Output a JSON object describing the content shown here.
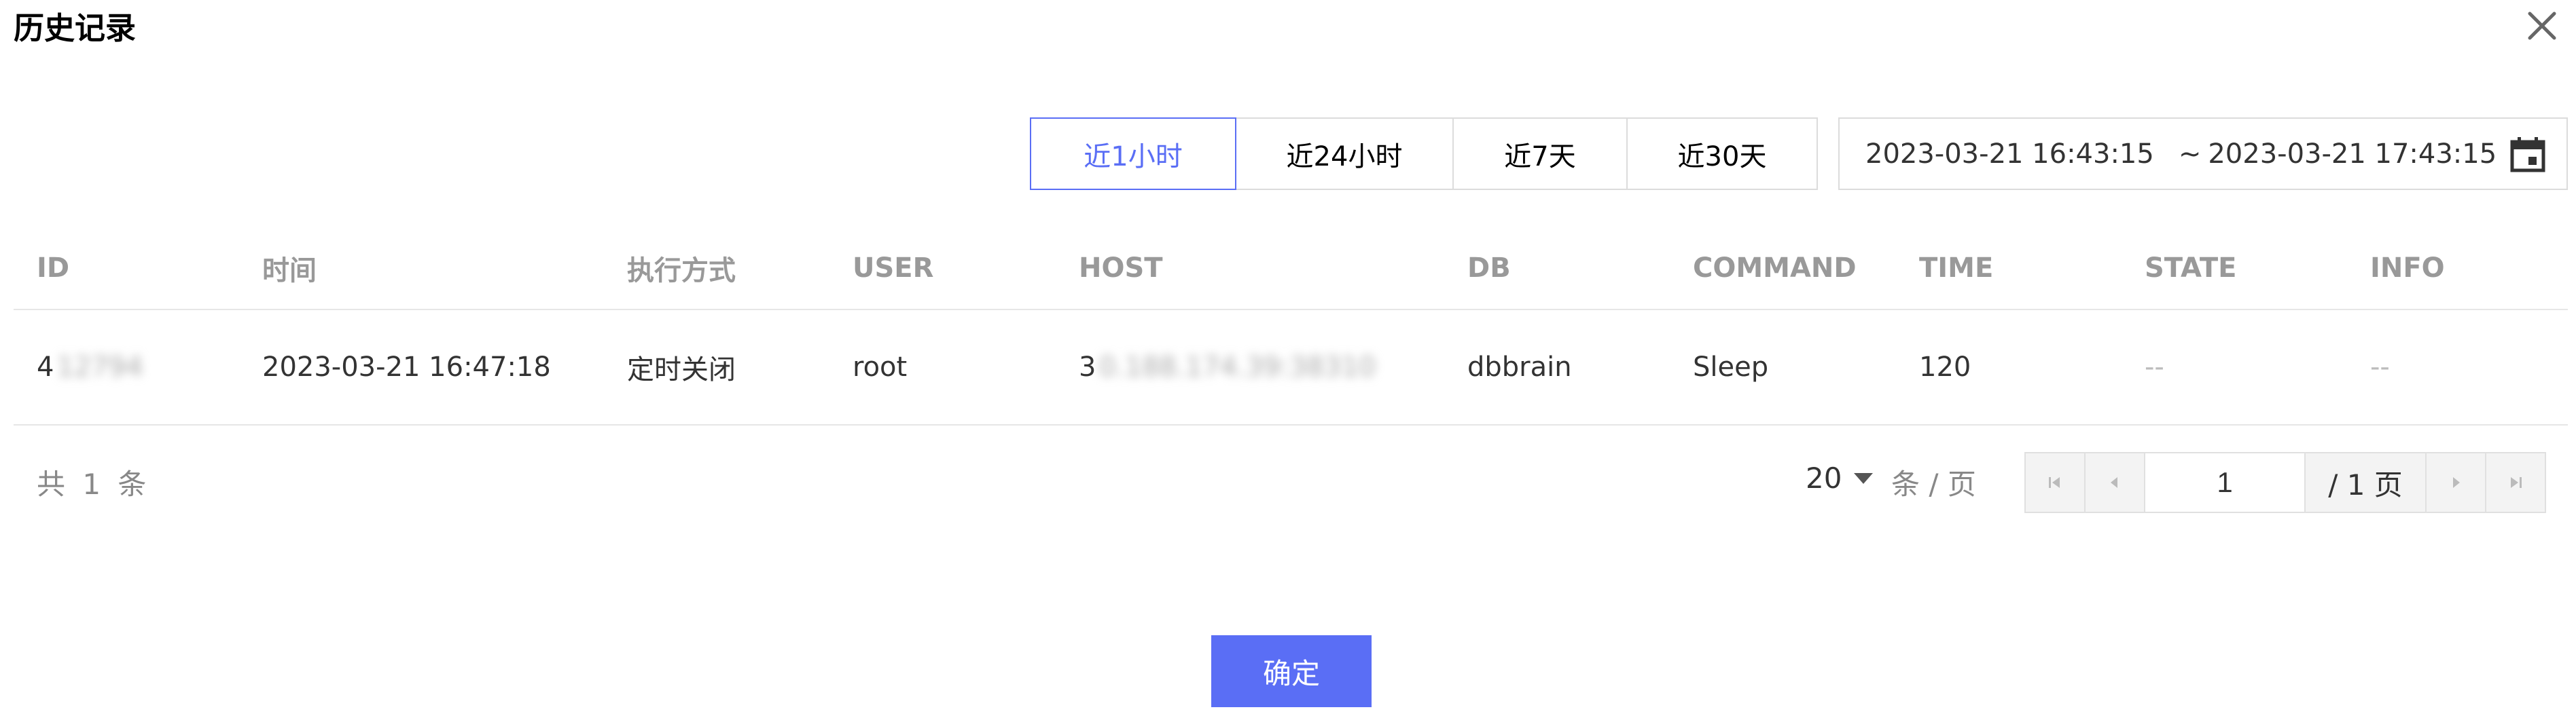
{
  "dialog": {
    "title": "历史记录",
    "close_icon": "close-icon"
  },
  "range_tabs": [
    {
      "label": "近1小时",
      "active": true
    },
    {
      "label": "近24小时",
      "active": false
    },
    {
      "label": "近7天",
      "active": false
    },
    {
      "label": "近30天",
      "active": false
    }
  ],
  "date_range": {
    "start": "2023-03-21 16:43:15",
    "separator": "~",
    "end": "2023-03-21 17:43:15",
    "icon": "calendar-icon"
  },
  "table": {
    "headers": [
      "ID",
      "时间",
      "执行方式",
      "USER",
      "HOST",
      "DB",
      "COMMAND",
      "TIME",
      "STATE",
      "INFO"
    ],
    "rows": [
      {
        "id_visible": "4",
        "id_blurred": "12794",
        "time": "2023-03-21 16:47:18",
        "mode": "定时关闭",
        "user": "root",
        "host_visible": "3",
        "host_blurred": "0.188.174.39:38310",
        "db": "dbbrain",
        "command": "Sleep",
        "time_sec": "120",
        "state": "--",
        "info": "--"
      }
    ]
  },
  "pagination": {
    "total_text": "共 1 条",
    "page_size": "20",
    "per_page_label": "条 / 页",
    "current_page": "1",
    "total_pages_text": "/ 1 页"
  },
  "footer": {
    "confirm_label": "确定"
  },
  "colors": {
    "accent": "#5a6ef5",
    "border": "#dcdcdc",
    "header_text": "#999999"
  }
}
